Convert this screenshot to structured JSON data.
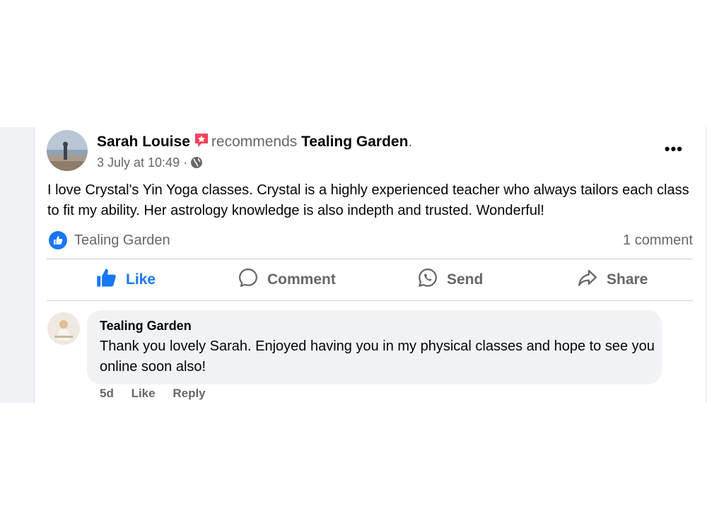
{
  "post": {
    "author": "Sarah Louise",
    "recommends": "recommends",
    "page_name": "Tealing Garden",
    "period": ".",
    "timestamp": "3 July at 10:49",
    "separator": "·",
    "privacy_icon": "globe-icon",
    "more_label": "•••",
    "text": "I love Crystal's Yin Yoga classes. Crystal is a highly experienced teacher who always tailors each class to fit my ability. Her astrology knowledge is also indepth and trusted. Wonderful!"
  },
  "reactions": {
    "reactor": "Tealing Garden",
    "comment_count": "1 comment"
  },
  "actions": {
    "like": "Like",
    "comment": "Comment",
    "send": "Send",
    "share": "Share"
  },
  "comment": {
    "author": "Tealing Garden",
    "text": "Thank you lovely Sarah. Enjoyed having you in my physical classes and hope to see you online soon also!",
    "age": "5d",
    "like": "Like",
    "reply": "Reply"
  },
  "colors": {
    "accent": "#1877f2",
    "muted_text": "#65676b",
    "bubble_bg": "#f0f2f5",
    "recommend_badge": "#f3425f"
  }
}
